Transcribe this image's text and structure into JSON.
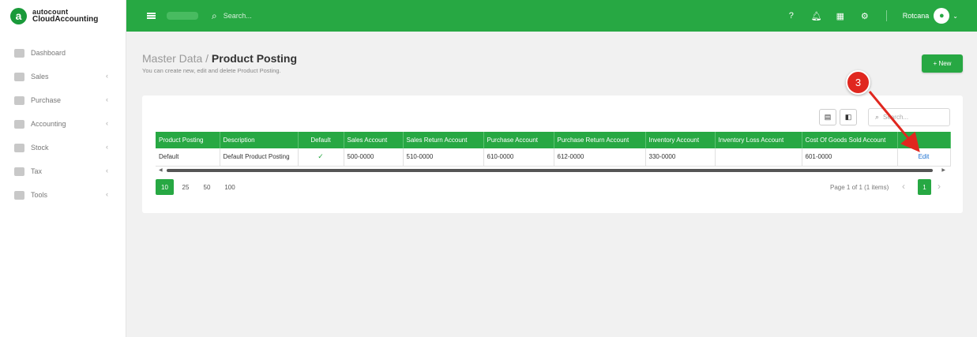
{
  "brand": {
    "top": "autocount",
    "bottom": "CloudAccounting",
    "logo": "a"
  },
  "sidebar": {
    "items": [
      {
        "label": "Dashboard",
        "icon": "dashboard-icon",
        "has_children": false
      },
      {
        "label": "Sales",
        "icon": "sales-icon",
        "has_children": true
      },
      {
        "label": "Purchase",
        "icon": "purchase-icon",
        "has_children": true
      },
      {
        "label": "Accounting",
        "icon": "accounting-icon",
        "has_children": true
      },
      {
        "label": "Stock",
        "icon": "stock-icon",
        "has_children": true
      },
      {
        "label": "Tax",
        "icon": "tax-icon",
        "has_children": true
      },
      {
        "label": "Tools",
        "icon": "wrench-icon",
        "has_children": true
      }
    ]
  },
  "topbar": {
    "search_placeholder": "Search...",
    "user_name": "Rotcana"
  },
  "page": {
    "breadcrumb_parent": "Master Data / ",
    "title": "Product Posting",
    "subtitle": "You can create new, edit and delete Product Posting.",
    "new_label": "+ New"
  },
  "table": {
    "search_placeholder": "Search...",
    "columns": [
      "Product Posting",
      "Description",
      "Default",
      "Sales Account",
      "Sales Return Account",
      "Purchase Account",
      "Purchase Return Account",
      "Inventory Account",
      "Inventory Loss Account",
      "Cost Of Goods Sold Account",
      ""
    ],
    "rows": [
      {
        "product_posting": "Default",
        "description": "Default Product Posting",
        "default": true,
        "sales_account": "500-0000",
        "sales_return_account": "510-0000",
        "purchase_account": "610-0000",
        "purchase_return_account": "612-0000",
        "inventory_account": "330-0000",
        "inventory_loss_account": "",
        "cogs_account": "601-0000",
        "action": "Edit"
      }
    ]
  },
  "pagination": {
    "page_sizes": [
      "10",
      "25",
      "50",
      "100"
    ],
    "active_size": "10",
    "info": "Page 1 of 1 (1 items)",
    "current_page": "1"
  },
  "annotation": {
    "number": "3",
    "color": "#e0271f"
  },
  "colors": {
    "accent": "#27a843",
    "link": "#1a6fd1"
  }
}
